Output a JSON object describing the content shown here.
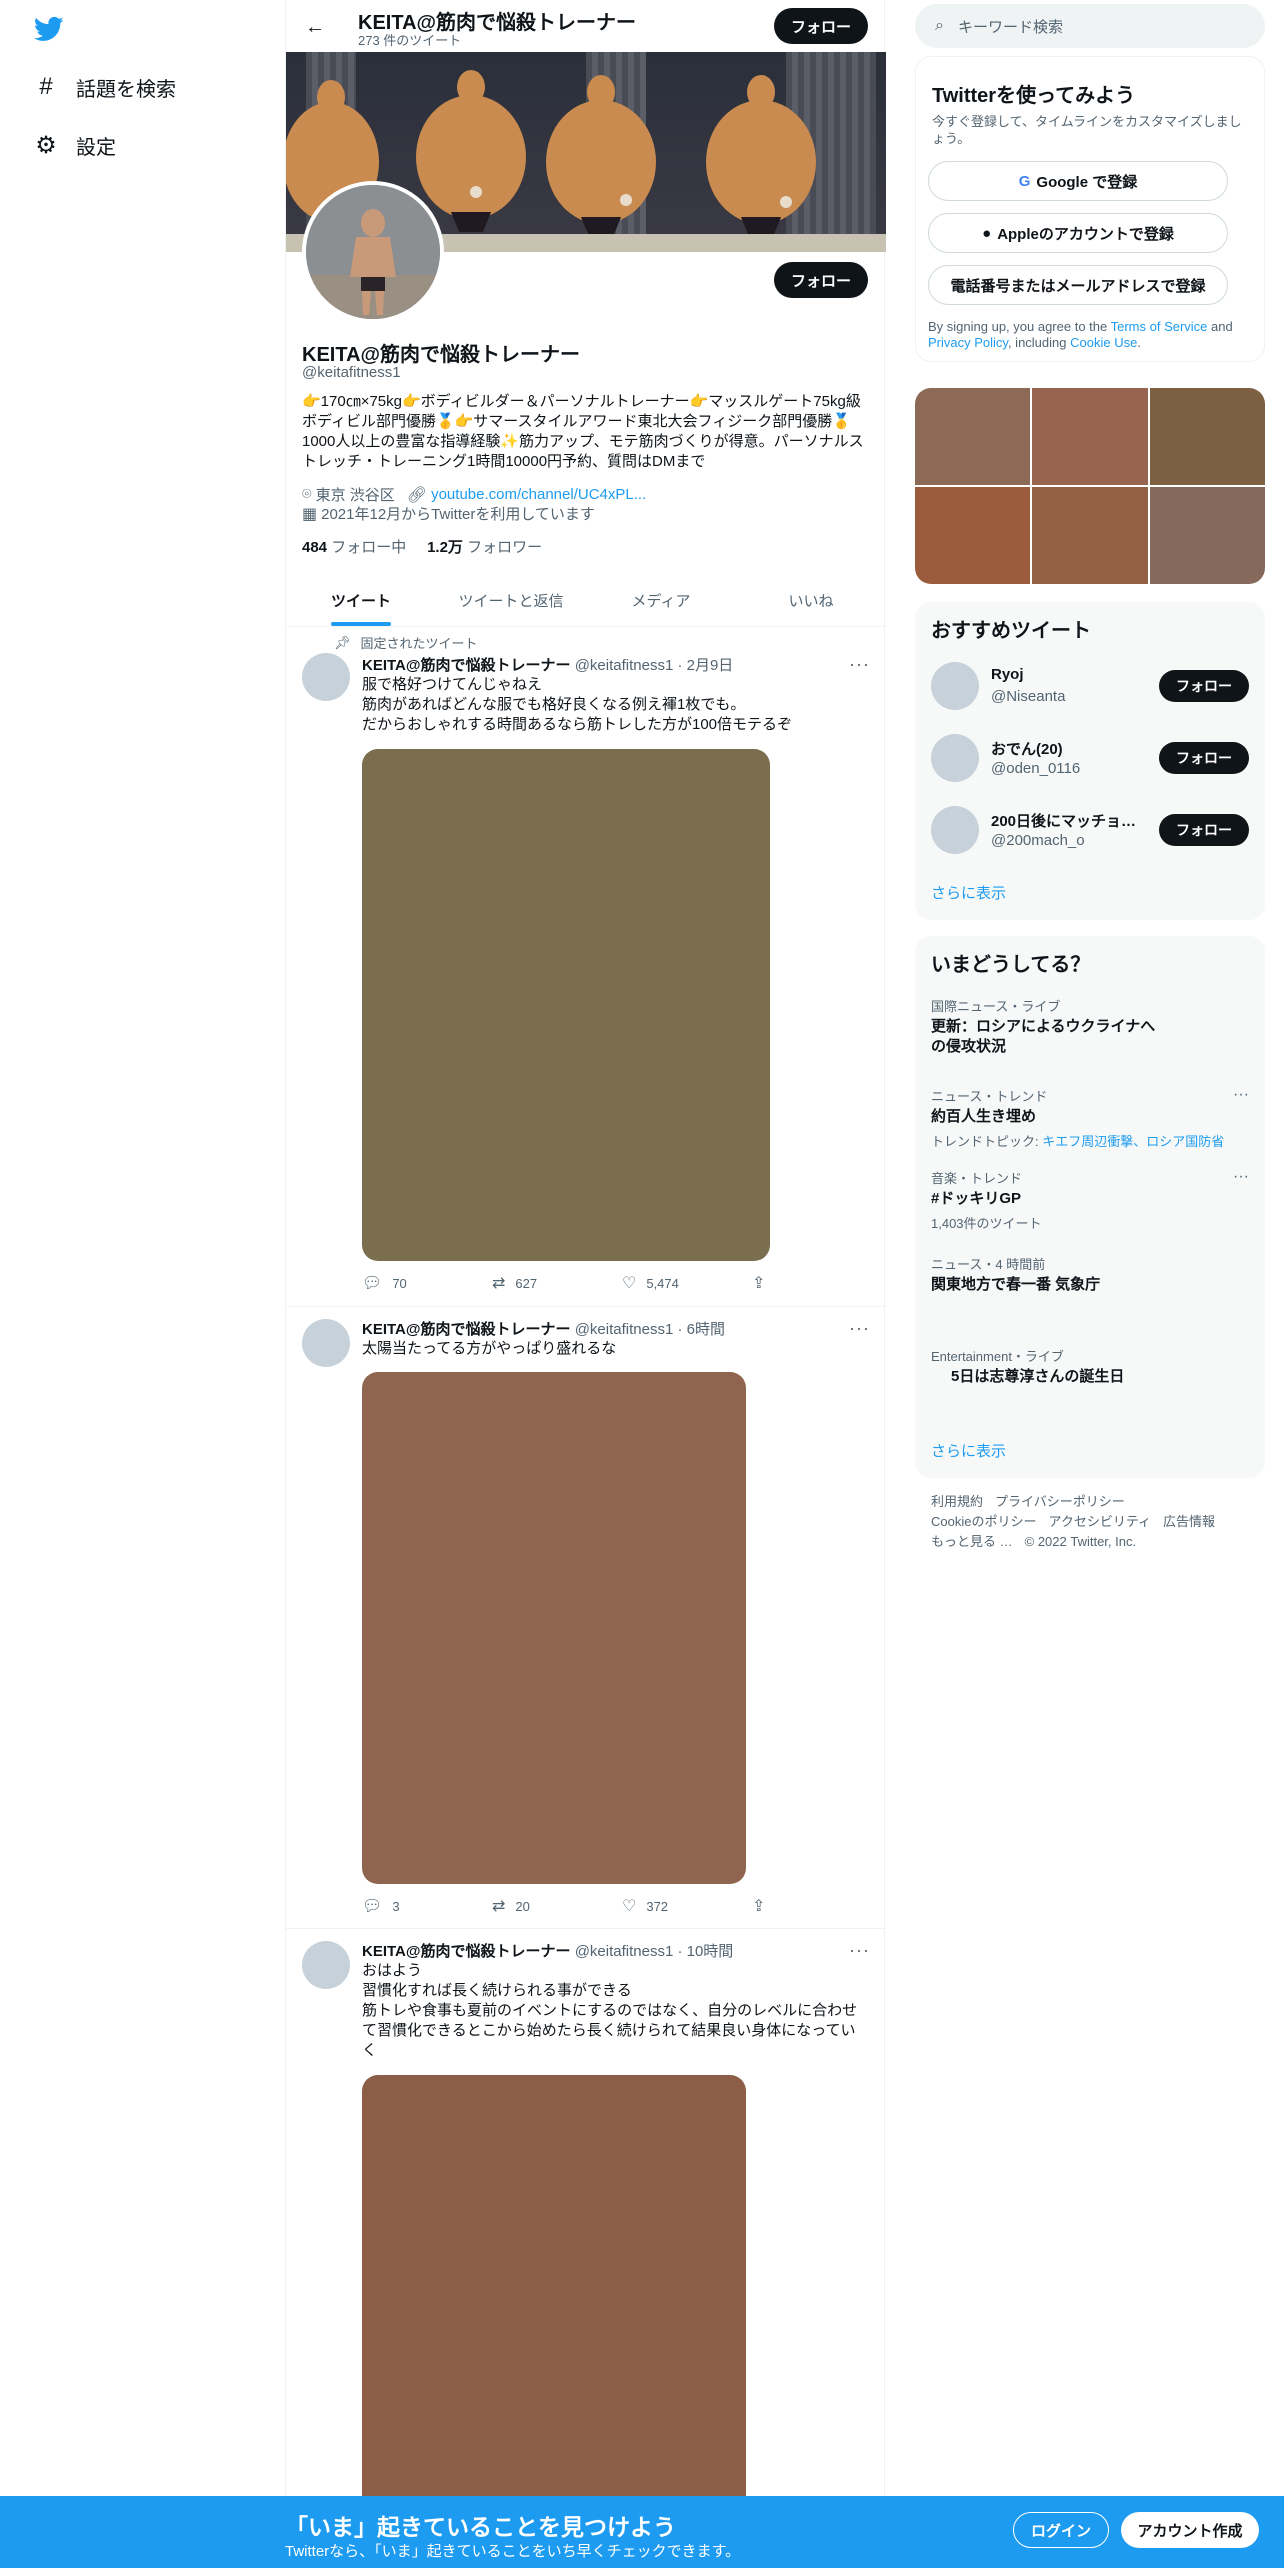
{
  "nav": {
    "items": [
      {
        "label": "話題を検索",
        "icon": "hashtag-icon"
      },
      {
        "label": "設定",
        "icon": "gear-icon"
      }
    ]
  },
  "header": {
    "name": "KEITA@筋肉で悩殺トレーナー",
    "tweet_count": "273 件のツイート",
    "follow_label": "フォロー"
  },
  "profile": {
    "follow_label": "フォロー",
    "name": "KEITA@筋肉で悩殺トレーナー",
    "handle": "@keitafitness1",
    "bio": "👉170㎝×75kg👉ボディビルダー＆パーソナルトレーナー👉マッスルゲート75kg級ボディビル部門優勝🥇👉サマースタイルアワード東北大会フィジーク部門優勝🥇1000人以上の豊富な指導経験✨筋力アップ、モテ筋肉づくりが得意。パーソナルストレッチ・トレーニング1時間10000円予約、質問はDMまで",
    "location": "東京 渋谷区",
    "link": "youtube.com/channel/UC4xPL...",
    "joined": "2021年12月からTwitterを利用しています",
    "following_count": "484",
    "following_label": "フォロー中",
    "followers_count": "1.2万",
    "followers_label": "フォロワー"
  },
  "tabs": [
    "ツイート",
    "ツイートと返信",
    "メディア",
    "いいね"
  ],
  "tweets": [
    {
      "pinned_label": "固定されたツイート",
      "name": "KEITA@筋肉で悩殺トレーナー",
      "meta": "@keitafitness1 · 2月9日",
      "lines": [
        "服で格好つけてんじゃねえ",
        "筋肉があればどんな服でも格好良くなる例え褌1枚でも。",
        "だからおしゃれする時間あるなら筋トレした方が100倍モテるぞ"
      ],
      "image_color": "#7a6e4e",
      "replies": "70",
      "retweets": "627",
      "likes": "5,474"
    },
    {
      "name": "KEITA@筋肉で悩殺トレーナー",
      "meta": "@keitafitness1 · 6時間",
      "lines": [
        "太陽当たってる方がやっぱり盛れるな"
      ],
      "image_color": "#8f6550",
      "replies": "3",
      "retweets": "20",
      "likes": "372"
    },
    {
      "name": "KEITA@筋肉で悩殺トレーナー",
      "meta": "@keitafitness1 · 10時間",
      "lines": [
        "おはよう",
        "習慣化すれば長く続けられる事ができる",
        "筋トレや食事も夏前のイベントにするのではなく、自分のレベルに合わせて習慣化できるとこから始めたら長く続けられて結果良い身体になっていく"
      ],
      "image_color": "#8c5d47"
    }
  ],
  "search": {
    "placeholder": "キーワード検索"
  },
  "signup": {
    "title": "Twitterを使ってみよう",
    "subtitle": "今すぐ登録して、タイムラインをカスタマイズしましょう。",
    "google": "Google で登録",
    "apple": "Appleのアカウントで登録",
    "phone": "電話番号またはメールアドレスで登録",
    "terms_prefix": "By signing up, you agree to the ",
    "terms_tos": "Terms of Service",
    "terms_and": " and ",
    "terms_privacy": "Privacy Policy",
    "terms_including": ", including ",
    "terms_cookie": "Cookie Use",
    "terms_end": "."
  },
  "photo_grid_colors": [
    "#8c6a55",
    "#96644f",
    "#7c6041",
    "#9b5c3d",
    "#935f45",
    "#856a5b"
  ],
  "recommended": {
    "title": "おすすめツイート",
    "users": [
      {
        "name": "Ryoj",
        "handle": "@Niseanta"
      },
      {
        "name": "おでん(20)",
        "handle": "@oden_0116"
      },
      {
        "name": "200日後にマッチョ…",
        "handle": "@200mach_o"
      }
    ],
    "follow_label": "フォロー",
    "more": "さらに表示"
  },
  "trends": {
    "title": "いまどうしてる？",
    "items": [
      {
        "context": "国際ニュース・ライブ",
        "title": "更新：ロシアによるウクライナへの侵攻状況"
      },
      {
        "context": "ニュース・トレンド",
        "title": "約百人生き埋め",
        "topic_label": "トレンドトピック: ",
        "topic": "キエフ周辺衝撃、ロシア国防省"
      },
      {
        "context": "音楽・トレンド",
        "title": "#ドッキリGP",
        "sub": "1,403件のツイート"
      },
      {
        "context": "ニュース・4 時間前",
        "title": "関東地方で春一番 気象庁"
      },
      {
        "context": "Entertainment・ライブ",
        "title": "5日は志尊淳さんの誕生日"
      }
    ],
    "more": "さらに表示"
  },
  "footer": {
    "links": [
      "利用規約",
      "プライバシーポリシー",
      "Cookieのポリシー",
      "アクセシビリティ",
      "広告情報",
      "もっと見る …"
    ],
    "copyright": "© 2022 Twitter, Inc."
  },
  "bottom": {
    "headline": "「いま」起きていることを見つけよう",
    "subline": "Twitterなら、「いま」起きていることをいち早くチェックできます。",
    "login": "ログイン",
    "signup": "アカウント作成"
  },
  "colors": {
    "accent": "#1d9bf0",
    "dark": "#0f1419",
    "muted": "#536471"
  }
}
